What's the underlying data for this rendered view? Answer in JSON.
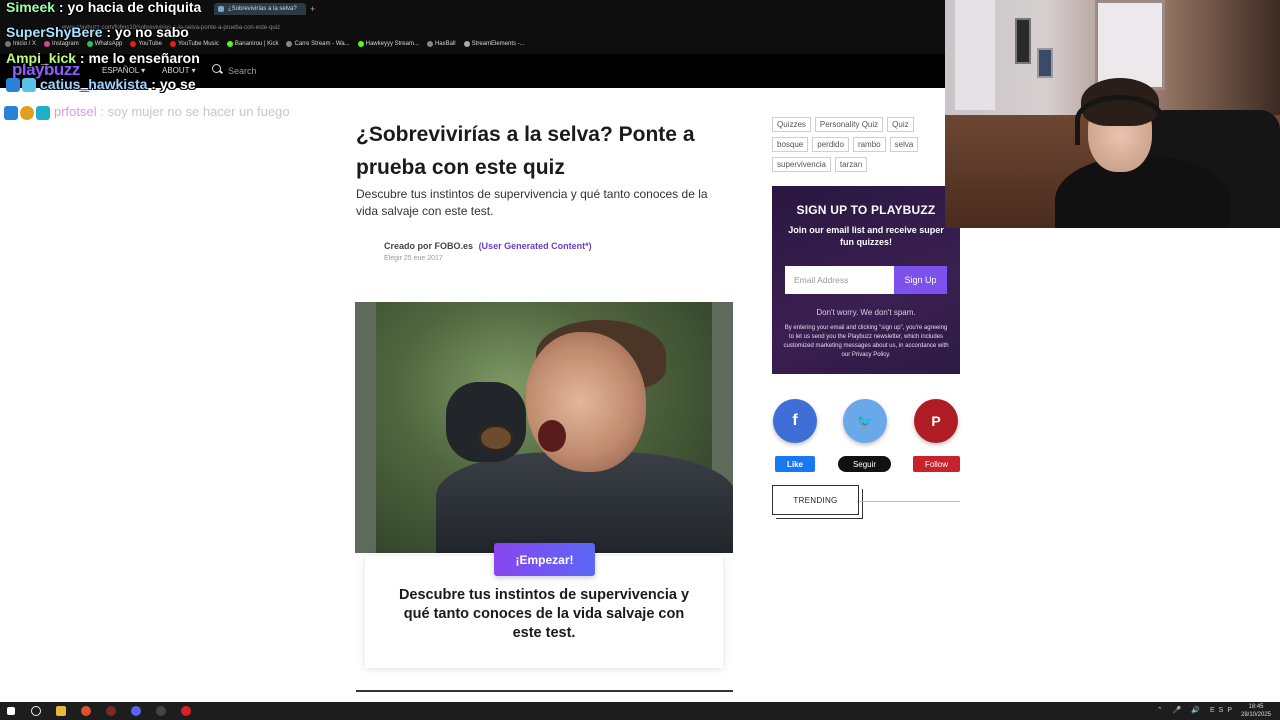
{
  "browser": {
    "tab_title": "¿Sobrevivirías a la selva?",
    "url": "www.playbuzz.com/fobos10/sobrevivirias-a-la-selva-ponte-a-prueba-con-este-quiz",
    "bookmarks": [
      "Inicio / X",
      "Instagram",
      "WhatsApp",
      "YouTube",
      "YouTube Music",
      "Bananirou | Kick",
      "Carre Stream - Wa...",
      "Hawkeyyy Stream...",
      "HaxBall",
      "StreamElements -..."
    ]
  },
  "site_nav": {
    "logo": "playbuzz",
    "language": "ESPAÑOL ▾",
    "about": "ABOUT ▾",
    "search_placeholder": "Search"
  },
  "chat": [
    {
      "user": "Simeek",
      "message": " : yo hacia de chiquita"
    },
    {
      "user": "SuperShyBere",
      "message": " : yo no sabo"
    },
    {
      "user": "Ampi_kick",
      "message": " : me lo enseñaron"
    },
    {
      "user": "catius_hawkista",
      "message": " : yo se"
    }
  ],
  "chat_faded": {
    "user": "prfotsel",
    "message": " : soy mujer no se hacer un fuego"
  },
  "article": {
    "title": "¿Sobrevivirías a la selva? Ponte a prueba con este quiz",
    "description": "Descubre tus instintos de supervivencia y qué tanto conoces de la vida salvaje con este test.",
    "created_by_label": "Creado por",
    "author": "FOBO.es",
    "ugc_link": "(User Generated Content*)",
    "date": "Elegir 25 ene 2017",
    "start_button": "¡Empezar!",
    "intro_text": "Descubre tus instintos de supervivencia y qué tanto conoces de la vida salvaje con este test."
  },
  "sidebar": {
    "tags": [
      "Quizzes",
      "Personality Quiz",
      "Quiz",
      "bosque",
      "perdido",
      "rambo",
      "selva",
      "supervivencia",
      "tarzan"
    ],
    "signup": {
      "title": "SIGN UP TO PLAYBUZZ",
      "subtitle": "Join our email list and receive super fun quizzes!",
      "email_placeholder": "Email Address",
      "button": "Sign Up",
      "no_spam": "Don't worry. We don't spam.",
      "legal": "By entering your email and clicking \"sign up\", you're agreeing to let us send you the Playbuzz newsletter, which includes customized marketing messages about us, in accordance with our Privacy Policy."
    },
    "share": {
      "facebook": "f",
      "twitter": "🐦",
      "pinterest": "P"
    },
    "buttons": {
      "like": "Like",
      "seguir": "Seguir",
      "follow": "Follow"
    },
    "trending": "TRENDING"
  },
  "taskbar": {
    "tray": "⌃ 🎤 🔊 ESP",
    "time": "18:45",
    "date": "28/10/2025"
  },
  "colors": {
    "brand_purple": "#8c5cff",
    "start_gradient": [
      "#8a45f0",
      "#5b67f5"
    ],
    "facebook": "#3f6ed6",
    "twitter": "#6aa9e9",
    "pinterest": "#b01c24"
  }
}
